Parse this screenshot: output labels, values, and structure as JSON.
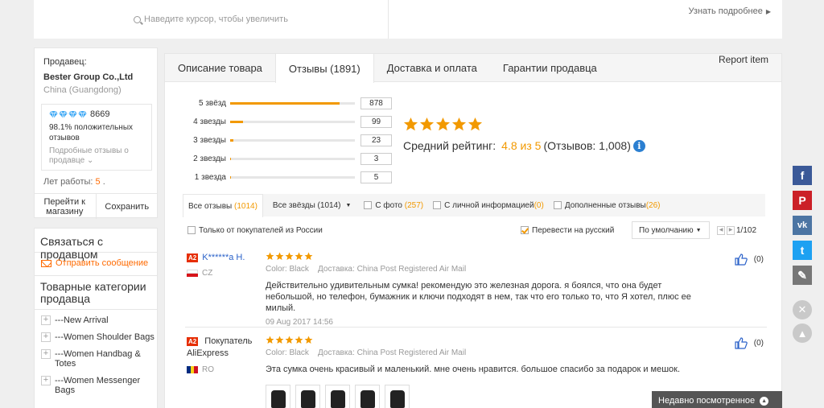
{
  "topbar": {
    "zoom_hint": "Наведите курсор, чтобы увеличить",
    "learn_more": "Узнать подробнее"
  },
  "seller": {
    "label": "Продавец:",
    "name": "Bester Group Co.,Ltd",
    "location": "China (Guangdong)",
    "score": "8669",
    "positive_pct": "98.1%",
    "positive_text": "положительных отзывов",
    "detailed_feedback": "Подробные отзывы о продавце",
    "years_label": "Лет работы:",
    "years_value": "5",
    "years_suffix": ".",
    "go_to_store": "Перейти к магазину",
    "save": "Сохранить"
  },
  "contact": {
    "title": "Связаться с продавцом",
    "send_message": "Отправить сообщение"
  },
  "categories": {
    "title": "Товарные категории продавца",
    "items": [
      "---New Arrival",
      "---Women Shoulder Bags",
      "---Women Handbag & Totes",
      "---Women Messenger Bags"
    ]
  },
  "tabs": {
    "description": "Описание товара",
    "reviews": "Отзывы (1891)",
    "shipping": "Доставка и оплата",
    "guarantees": "Гарантии продавца",
    "report": "Report item"
  },
  "histogram": [
    {
      "label": "5 звёзд",
      "count": "878",
      "fill": 0.875
    },
    {
      "label": "4 звезды",
      "count": "99",
      "fill": 0.1
    },
    {
      "label": "3 звезды",
      "count": "23",
      "fill": 0.025
    },
    {
      "label": "2 звезды",
      "count": "3",
      "fill": 0.005
    },
    {
      "label": "1 звезда",
      "count": "5",
      "fill": 0.008
    }
  ],
  "average": {
    "label": "Средний рейтинг:",
    "value": "4.8 из 5",
    "total": "(Отзывов: 1,008)",
    "stars": 5
  },
  "filters": {
    "all_reviews": "Все отзывы",
    "all_reviews_count": "(1014)",
    "all_stars": "Все звёзды",
    "all_stars_count": "(1014)",
    "with_photo": "С фото",
    "with_photo_count": "(257)",
    "with_personal": "С личной информацией",
    "with_personal_count": "(0)",
    "additional": "Дополненные отзывы",
    "additional_count": "(26)"
  },
  "options": {
    "russia_only": "Только от покупателей из России",
    "translate": "Перевести на русский",
    "sort": "По умолчанию",
    "page": "1/102"
  },
  "reviews": [
    {
      "badge": "A2",
      "name": "K******a H.",
      "country": "CZ",
      "color_label": "Color:",
      "color": "Black",
      "delivery_label": "Доставка:",
      "delivery": "China Post Registered Air Mail",
      "text": "Действительно удивительным сумка! рекомендую это железная дорога. я боялся, что она будет небольшой, но телефон, бумажник и ключи подходят в нем, так что его только то, что Я хотел, плюс ее милый.",
      "date": "09 Aug 2017 14:56",
      "likes": "(0)",
      "stars": 5
    },
    {
      "badge": "A2",
      "name": "Покупатель AliExpress",
      "country": "RO",
      "color_label": "Color:",
      "color": "Black",
      "delivery_label": "Доставка:",
      "delivery": "China Post Registered Air Mail",
      "text": "Эта сумка очень красивый и маленький. мне очень нравится. большое спасибо за подарок и мешок.",
      "likes": "(0)",
      "stars": 5,
      "photos": 5
    }
  ],
  "social": [
    {
      "name": "facebook",
      "glyph": "f",
      "color": "#3b5998"
    },
    {
      "name": "pinterest",
      "glyph": "P",
      "color": "#cb2027"
    },
    {
      "name": "vk",
      "glyph": "vk",
      "color": "#4c75a3"
    },
    {
      "name": "twitter",
      "glyph": "t",
      "color": "#1da1f2"
    },
    {
      "name": "edit",
      "glyph": "✎",
      "color": "#777777"
    }
  ],
  "recently_viewed": "Недавно посмотренное",
  "colors": {
    "accent_orange": "#f29900",
    "link_blue": "#2b62c9",
    "brand_red": "#e62e04"
  }
}
